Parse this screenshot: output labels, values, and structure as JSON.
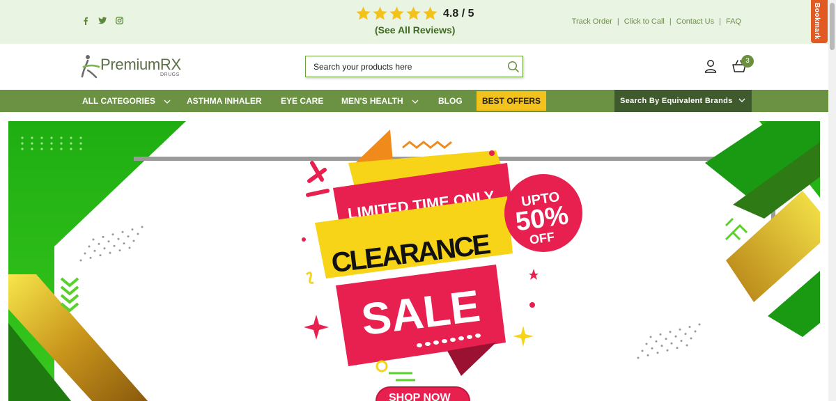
{
  "topbar": {
    "social_icons": [
      "facebook-icon",
      "twitter-icon",
      "instagram-icon"
    ],
    "rating": {
      "stars": 5,
      "value": "4.8 / 5",
      "reviews_link": "(See All Reviews)"
    },
    "links": [
      "Track Order",
      "Click to Call",
      "Contact Us",
      "FAQ"
    ],
    "bookmark_label": "Bookmark"
  },
  "header": {
    "logo_text": "PremiumRX",
    "logo_sub": "DRUGS",
    "search_placeholder": "Search your products here",
    "cart_count": "3"
  },
  "nav": {
    "items": [
      {
        "label": "ALL CATEGORIES",
        "has_dropdown": true
      },
      {
        "label": "ASTHMA INHALER",
        "has_dropdown": false
      },
      {
        "label": "EYE CARE",
        "has_dropdown": false
      },
      {
        "label": "MEN'S HEALTH",
        "has_dropdown": true
      },
      {
        "label": "BLOG",
        "has_dropdown": false
      },
      {
        "label": "BEST OFFERS",
        "has_dropdown": false
      }
    ],
    "equivalent_brands": "Search By Equivalent Brands"
  },
  "banner": {
    "ribbon_top": "LIMITED TIME ONLY",
    "headline": "CLEARANCE",
    "sale": "SALE",
    "badge_line1": "UPTO",
    "badge_line2": "50%",
    "badge_line3": "OFF",
    "cta": "SHOP NOW"
  },
  "colors": {
    "topbar_bg": "#eaf4e2",
    "nav_bg": "#6b9242",
    "offers_bg": "#f4c21c",
    "equiv_bg": "#3f5a2c",
    "banner_green": "#2fbf18",
    "sale_pink": "#e8204f",
    "sale_yellow": "#f7d417"
  }
}
